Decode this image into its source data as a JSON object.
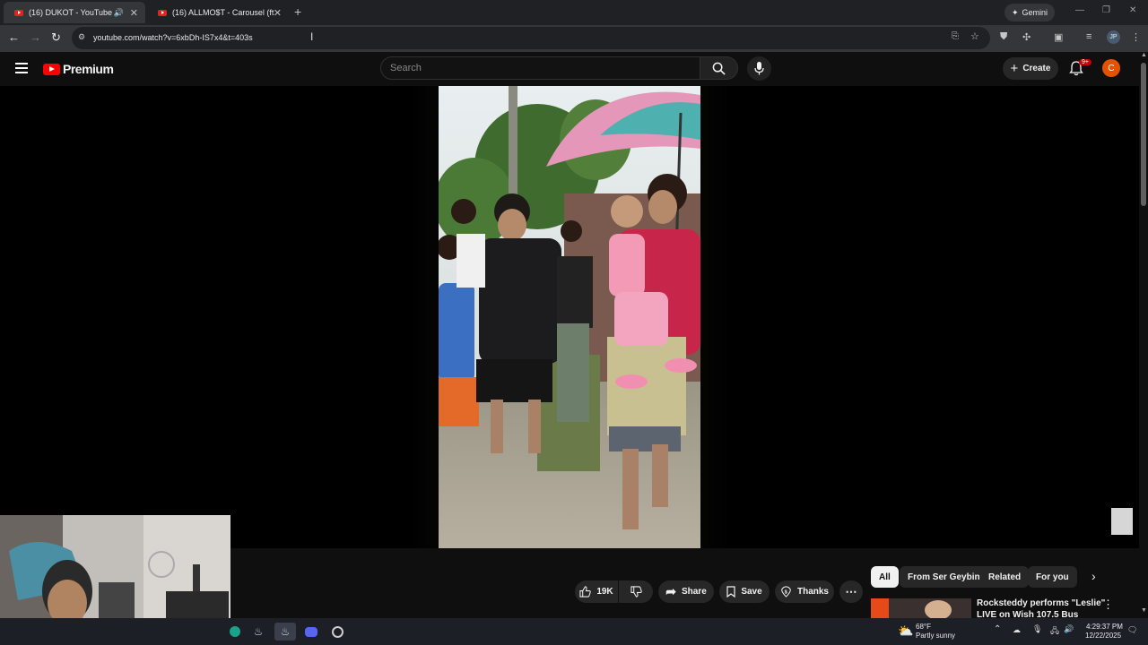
{
  "browser": {
    "tabs": [
      {
        "title": "(16) DUKOT - YouTube",
        "active": true
      },
      {
        "title": "(16) ALLMO$T - Carousel (ft. Yu",
        "active": false
      }
    ],
    "gemini_label": "Gemini",
    "url": "youtube.com/watch?v=6xbDh-IS7x4&t=403s",
    "profile_initials": "JP"
  },
  "youtube": {
    "logo_text": "Premium",
    "search_placeholder": "Search",
    "create_label": "Create",
    "notification_badge": "9+",
    "avatar_letter": "C"
  },
  "actions": {
    "like_count": "19K",
    "share_label": "Share",
    "save_label": "Save",
    "thanks_label": "Thanks"
  },
  "chips": [
    "All",
    "From Ser Geybin",
    "Related",
    "For you"
  ],
  "recommendation": {
    "title_line1": "Rocksteddy performs \"Leslie\"",
    "title_line2": "LIVE on Wish 107.5 Bus"
  },
  "taskbar": {
    "weather_temp": "68°F",
    "weather_desc": "Partly sunny",
    "time": "4:29:37 PM",
    "date": "12/22/2025"
  },
  "colors": {
    "yt_red": "#ff0000",
    "avatar": "#e65100",
    "badge": "#cc0000"
  }
}
